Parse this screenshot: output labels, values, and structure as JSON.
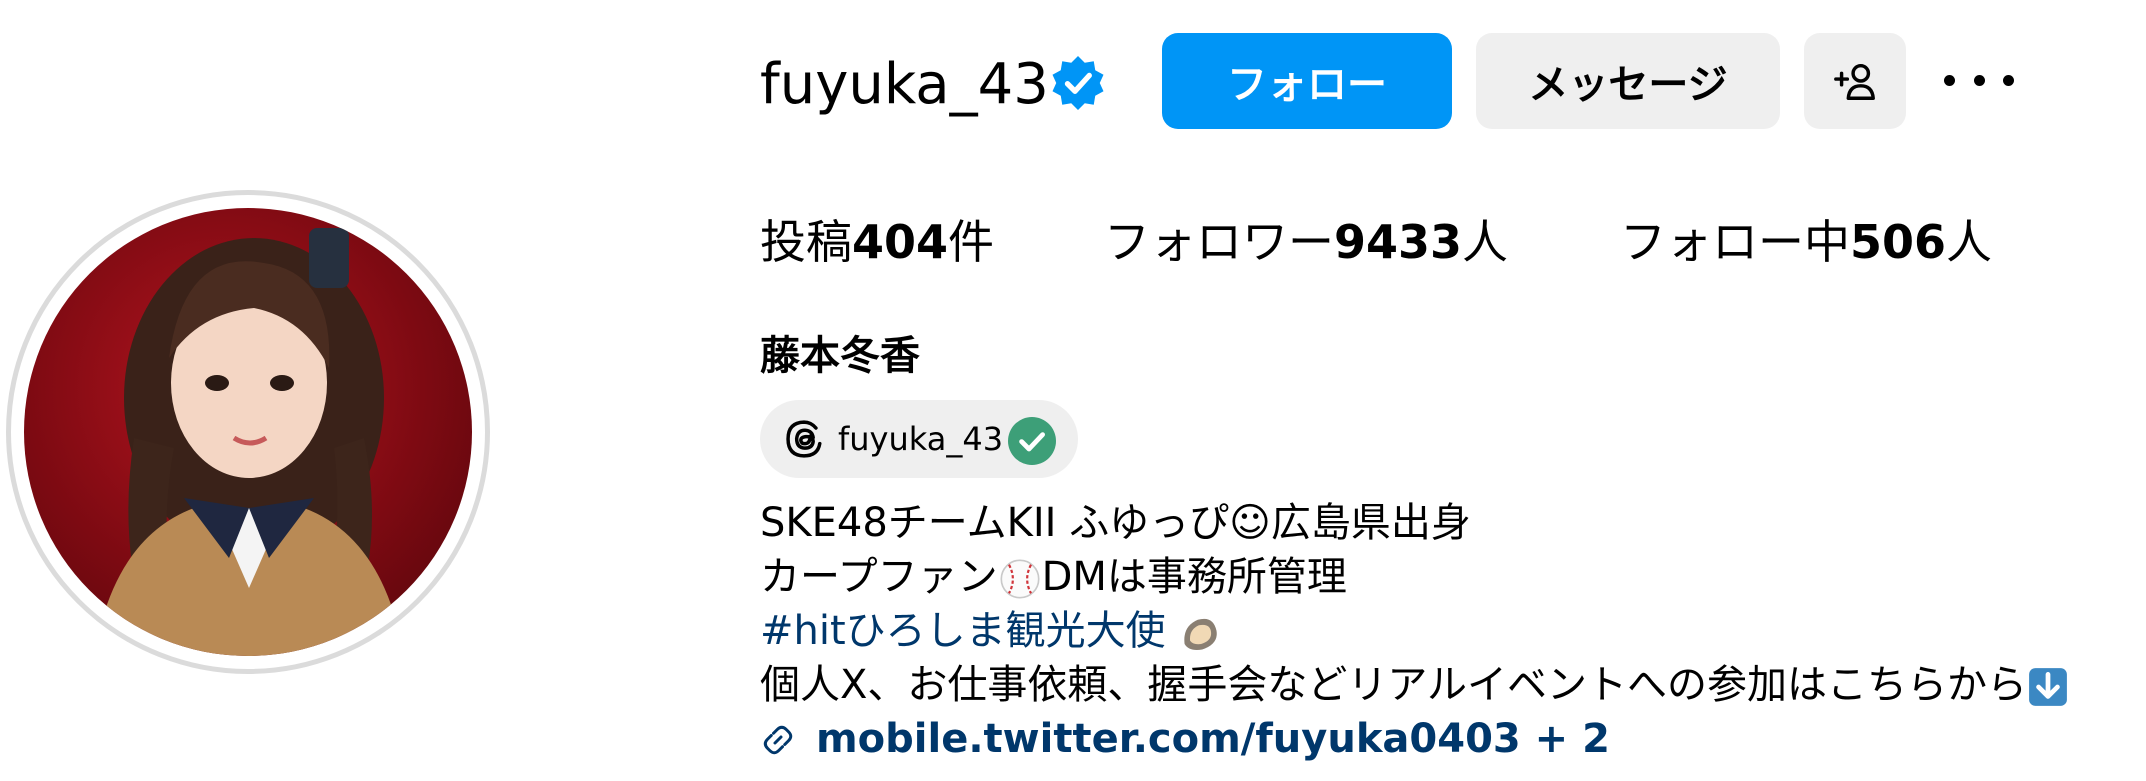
{
  "profile": {
    "username": "fuyuka_43",
    "verified_icon": "verified-badge-icon",
    "display_name": "藤本冬香",
    "avatar_icon": "profile-photo"
  },
  "actions": {
    "follow_label": "フォロー",
    "message_label": "メッセージ",
    "suggest_icon": "add-person-icon",
    "more_icon": "more-options-icon"
  },
  "stats": {
    "posts_prefix": "投稿",
    "posts_count": "404",
    "posts_suffix": "件",
    "followers_prefix": "フォロワー",
    "followers_count": "9433",
    "followers_suffix": "人",
    "following_prefix": "フォロー中",
    "following_count": "506",
    "following_suffix": "人"
  },
  "threads": {
    "handle": "fuyuka_43",
    "icon": "threads-logo-icon"
  },
  "bio": {
    "line1": "SKE48チームKII ふゆっぴ☺広島県出身",
    "line2_a": "カープファン",
    "line2_b": "DMは事務所管理",
    "line3": "#hitひろしま観光大使 ",
    "line4": "個人X、お仕事依頼、握手会などリアルイベントへの参加はこちらから",
    "link_text": "mobile.twitter.com/fuyuka0403 + 2"
  },
  "colors": {
    "primary": "#0095f6",
    "link": "#00376b",
    "button_gray": "#efefef",
    "threads_check": "#3d9f78"
  }
}
